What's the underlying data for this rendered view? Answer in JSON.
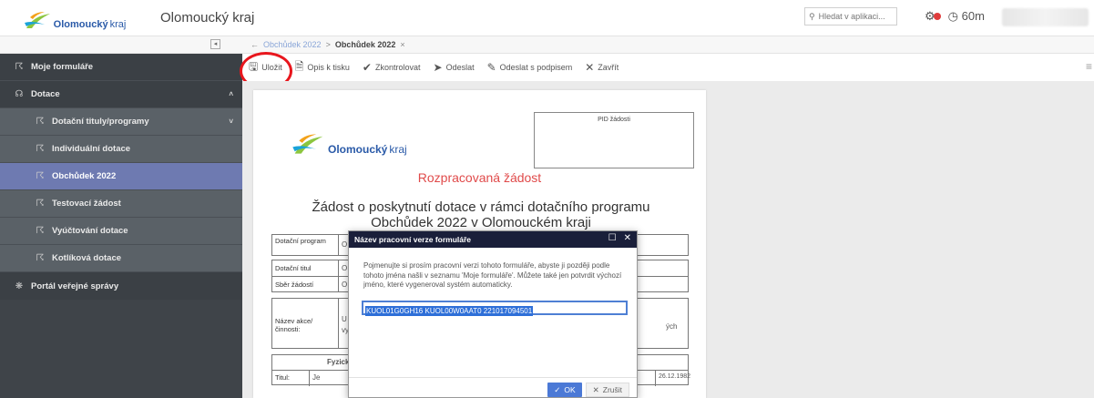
{
  "header": {
    "logo_bold": "Olomoucký",
    "logo_normal": "kraj",
    "app_title": "Olomoucký kraj",
    "search_placeholder": "Hledat v aplikaci...",
    "timer": "60m"
  },
  "breadcrumb": {
    "back": "←",
    "items": [
      "Obchůdek 2022",
      "Obchůdek 2022"
    ],
    "close": "×"
  },
  "sidebar": {
    "items": [
      {
        "label": "Moje formuláře"
      },
      {
        "label": "Dotace",
        "chevron": "^"
      },
      {
        "label": "Dotační tituly/programy",
        "chevron": "v"
      },
      {
        "label": "Individuální dotace"
      },
      {
        "label": "Obchůdek 2022"
      },
      {
        "label": "Testovací žádost"
      },
      {
        "label": "Vyúčtování dotace"
      },
      {
        "label": "Kotlíková dotace"
      },
      {
        "label": "Portál veřejné správy"
      }
    ]
  },
  "toolbar": {
    "save": "Uložit",
    "print": "Opis k tisku",
    "check": "Zkontrolovat",
    "send": "Odeslat",
    "send_signed": "Odeslat s podpisem",
    "close": "Zavřít"
  },
  "document": {
    "pid_label": "PID žádosti",
    "status": "Rozpracovaná žádost",
    "title_line1": "Žádost o poskytnutí dotace v rámci dotačního programu",
    "title_line2": "Obchůdek 2022 v Olomouckém kraji",
    "row1_label": "Dotační program",
    "row1_value": "O",
    "row2_label": "Dotační titul",
    "row2_value": "O",
    "row3_label": "Sběr žádostí",
    "row3_value": "O",
    "row4_label": "Název akce/ činnosti:",
    "row4_value": "U",
    "row4_value2": "vy",
    "row4_right": "ých",
    "fyz_label": "Fyzick",
    "titul_label": "Titul:",
    "titul_value": "Je",
    "date_value": "26.12.1982"
  },
  "modal": {
    "title": "Název pracovní verze formuláře",
    "text": "Pojmenujte si prosím pracovní verzi tohoto formuláře, abyste ji později podle tohoto jména našli v seznamu 'Moje formuláře'. Můžete také jen potvrdit výchozí jméno, které vygeneroval systém automaticky.",
    "input_value": "KUOL01G0GH16 KUOL00W0AAT0 221017094501",
    "ok": "OK",
    "cancel": "Zrušit"
  },
  "colors": {
    "sidebar_bg": "#3f4449",
    "sidebar_active": "#6e7ab1",
    "modal_header": "#1a1f3a",
    "primary_button": "#4b79d6",
    "status_red": "#e04a4a",
    "annotation_circle": "#e8161d"
  }
}
